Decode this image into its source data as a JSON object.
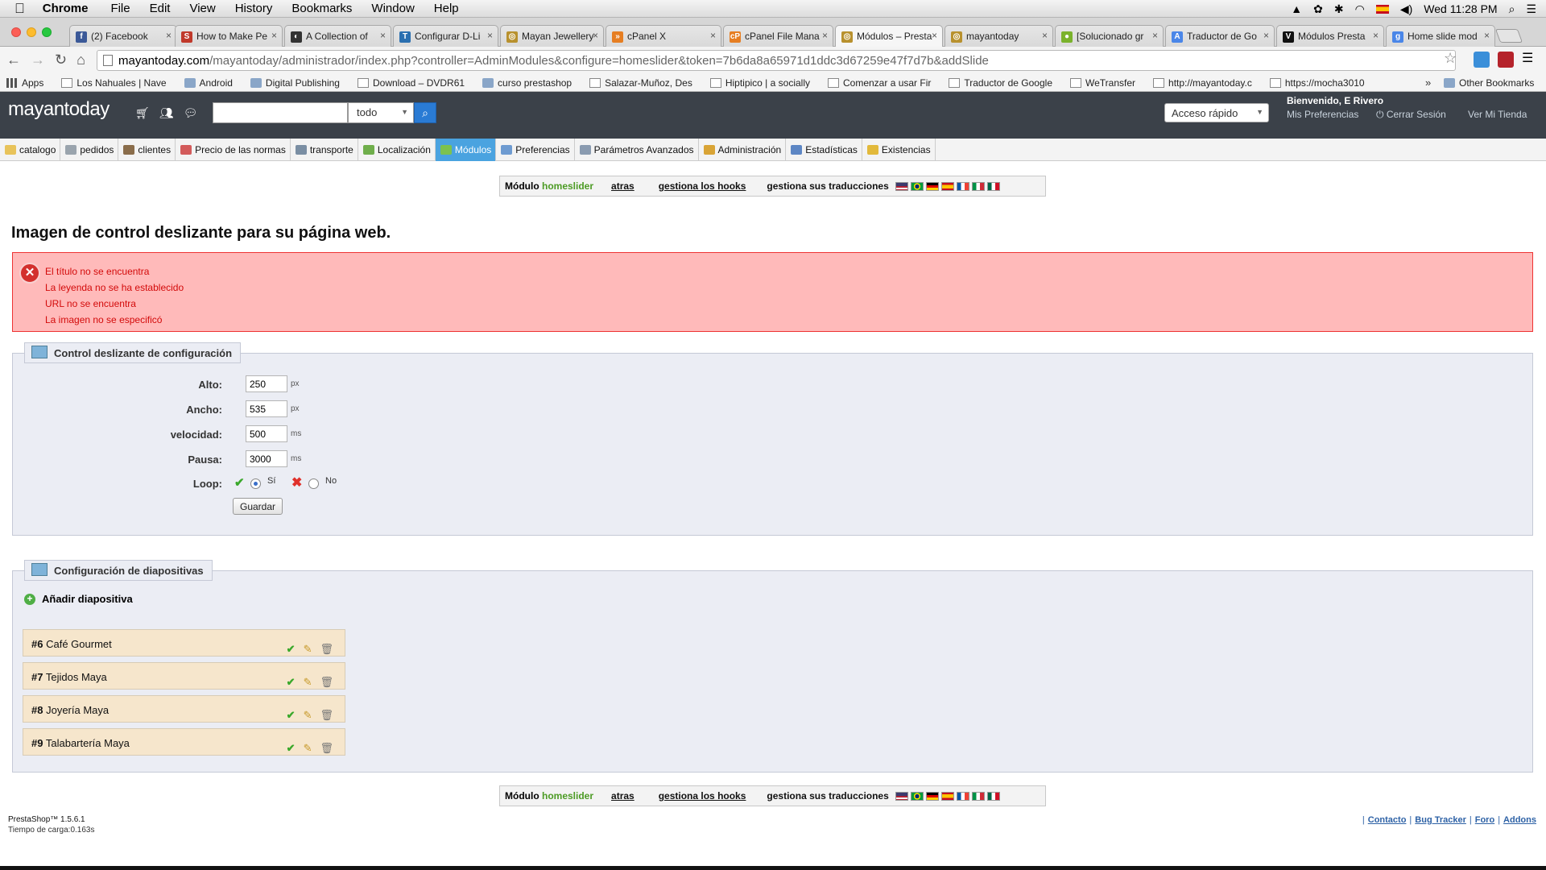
{
  "os_menubar": {
    "app": "Chrome",
    "menus": [
      "File",
      "Edit",
      "View",
      "History",
      "Bookmarks",
      "Window",
      "Help"
    ],
    "clock": "Wed 11:28 PM"
  },
  "browser": {
    "tabs": [
      {
        "label": "(2) Facebook",
        "fav": "f",
        "color": "#3b5998"
      },
      {
        "label": "How to Make Pe",
        "fav": "S",
        "color": "#c0392b"
      },
      {
        "label": "A Collection of",
        "fav": "◐",
        "color": "#333"
      },
      {
        "label": "Configurar D-Li",
        "fav": "T",
        "color": "#2a6fb0"
      },
      {
        "label": "Mayan Jewellery",
        "fav": "◎",
        "color": "#b8912e"
      },
      {
        "label": "cPanel X",
        "fav": "»",
        "color": "#e67e22"
      },
      {
        "label": "cPanel File Mana",
        "fav": "cP",
        "color": "#e67e22"
      },
      {
        "label": "Módulos – Presta",
        "fav": "◎",
        "color": "#b8912e"
      },
      {
        "label": "mayantoday",
        "fav": "◎",
        "color": "#b8912e"
      },
      {
        "label": "[Solucionado gr",
        "fav": "●",
        "color": "#7ab22c"
      },
      {
        "label": "Traductor de Go",
        "fav": "A",
        "color": "#4a86e8"
      },
      {
        "label": "Módulos Presta",
        "fav": "V",
        "color": "#111"
      },
      {
        "label": "Home slide mod",
        "fav": "g",
        "color": "#4a86e8"
      }
    ],
    "url_host": "mayantoday.com",
    "url_path": "/mayantoday/administrador/index.php?controller=AdminModules&configure=homeslider&token=7b6da8a65971d1ddc3d67259e47f7d7b&addSlide",
    "bookmarks": [
      {
        "label": "Apps",
        "icon": "apps"
      },
      {
        "label": "Los Nahuales | Nave",
        "icon": "page"
      },
      {
        "label": "Android",
        "icon": "folder"
      },
      {
        "label": "Digital Publishing",
        "icon": "folder"
      },
      {
        "label": "Download – DVDR61",
        "icon": "page"
      },
      {
        "label": "curso prestashop",
        "icon": "folder"
      },
      {
        "label": "Salazar-Muñoz, Des",
        "icon": "page"
      },
      {
        "label": "Hiptipico | a socially",
        "icon": "page"
      },
      {
        "label": "Comenzar a usar Fir",
        "icon": "page"
      },
      {
        "label": "Traductor de Google",
        "icon": "page"
      },
      {
        "label": "WeTransfer",
        "icon": "page"
      },
      {
        "label": "http://mayantoday.c",
        "icon": "page"
      },
      {
        "label": "https://mocha3010",
        "icon": "page"
      }
    ],
    "overflow": "»",
    "other_bookmarks": "Other Bookmarks"
  },
  "ps_header": {
    "logo": "mayantoday",
    "search_scope": "todo",
    "quick_access": "Acceso rápido",
    "welcome": "Bienvenido, E Rivero",
    "preferences": "Mis Preferencias",
    "logout": "Cerrar Sesión",
    "view_shop": "Ver Mi Tienda"
  },
  "admin_menu": [
    {
      "label": "catalogo",
      "color": "#e8c35a"
    },
    {
      "label": "pedidos",
      "color": "#9aa4ad"
    },
    {
      "label": "clientes",
      "color": "#8a6d4b"
    },
    {
      "label": "Precio de las normas",
      "color": "#d35b5b"
    },
    {
      "label": "transporte",
      "color": "#7a8ea3"
    },
    {
      "label": "Localización",
      "color": "#6fae4b"
    },
    {
      "label": "Módulos",
      "color": "#7cc24f",
      "active": true
    },
    {
      "label": "Preferencias",
      "color": "#6e9bd1"
    },
    {
      "label": "Parámetros Avanzados",
      "color": "#8a9bb0"
    },
    {
      "label": "Administración",
      "color": "#d9a436"
    },
    {
      "label": "Estadísticas",
      "color": "#5d86c4"
    },
    {
      "label": "Existencias",
      "color": "#e2b93b"
    }
  ],
  "module_toolbar": {
    "prefix": "Módulo",
    "module_name": "homeslider",
    "back": "atras",
    "hooks": "gestiona los hooks",
    "translations": "gestiona sus traducciones"
  },
  "page_title": "Imagen de control deslizante para su página web.",
  "errors": [
    "El título no se encuentra",
    "La leyenda no se ha establecido",
    "URL no se encuentra",
    "La imagen no se especificó"
  ],
  "config": {
    "legend": "Control deslizante de configuración",
    "height_label": "Alto:",
    "height_value": "250",
    "height_unit": "px",
    "width_label": "Ancho:",
    "width_value": "535",
    "width_unit": "px",
    "speed_label": "velocidad:",
    "speed_value": "500",
    "speed_unit": "ms",
    "pause_label": "Pausa:",
    "pause_value": "3000",
    "pause_unit": "ms",
    "loop_label": "Loop:",
    "loop_yes": "Sí",
    "loop_no": "No",
    "save": "Guardar"
  },
  "slides_section": {
    "legend": "Configuración de diapositivas",
    "add": "Añadir diapositiva",
    "slides": [
      {
        "id": "#6",
        "title": "Café Gourmet"
      },
      {
        "id": "#7",
        "title": "Tejidos Maya"
      },
      {
        "id": "#8",
        "title": "Joyería Maya"
      },
      {
        "id": "#9",
        "title": "Talabartería Maya"
      }
    ]
  },
  "footer": {
    "version": "PrestaShop™ 1.5.6.1",
    "load_time": "Tiempo de carga:0.163s",
    "links": [
      "Contacto",
      "Bug Tracker",
      "Foro",
      "Addons"
    ],
    "separator": "|"
  }
}
